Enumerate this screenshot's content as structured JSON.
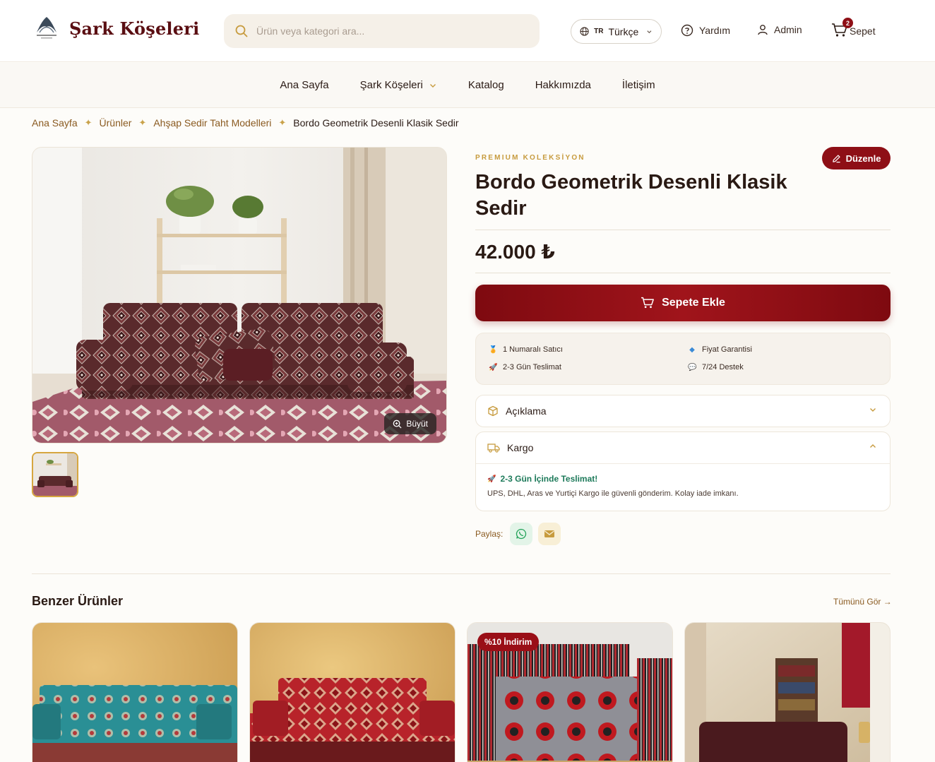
{
  "header": {
    "brand": "Şark Köşeleri",
    "search_placeholder": "Ürün veya kategori ara...",
    "language_code": "TR",
    "language_label": "Türkçe",
    "help_label": "Yardım",
    "account_label": "Admin",
    "cart_label": "Sepet",
    "cart_count": "2"
  },
  "nav": {
    "items": [
      {
        "label": "Ana Sayfa"
      },
      {
        "label": "Şark Köşeleri"
      },
      {
        "label": "Katalog"
      },
      {
        "label": "Hakkımızda"
      },
      {
        "label": "İletişim"
      }
    ]
  },
  "breadcrumb": {
    "items": [
      "Ana Sayfa",
      "Ürünler",
      "Ahşap Sedir Taht Modelleri"
    ],
    "current": "Bordo Geometrik Desenli Klasik Sedir"
  },
  "product": {
    "kicker": "PREMIUM KOLEKSİYON",
    "edit_label": "Düzenle",
    "title": "Bordo Geometrik Desenli Klasik Sedir",
    "price": "42.000 ₺",
    "zoom_label": "Büyüt",
    "add_to_cart": "Sepete Ekle",
    "features": [
      {
        "icon": "trophy-icon",
        "label": "1 Numaralı Satıcı"
      },
      {
        "icon": "diamond-icon",
        "label": "Fiyat Garantisi"
      },
      {
        "icon": "rocket-icon",
        "label": "2-3 Gün Teslimat"
      },
      {
        "icon": "chat-icon",
        "label": "7/24 Destek"
      }
    ],
    "accordion": {
      "description_label": "Açıklama",
      "shipping_label": "Kargo",
      "shipping_highlight": "2-3 Gün İçinde Teslimat!",
      "shipping_text": "UPS, DHL, Aras ve Yurtiçi Kargo ile güvenli gönderim. Kolay iade imkanı."
    },
    "share_label": "Paylaş:"
  },
  "similar": {
    "title": "Benzer Ürünler",
    "see_all": "Tümünü Gör →",
    "cards": [
      {
        "badge": ""
      },
      {
        "badge": ""
      },
      {
        "badge": "%10 İndirim"
      },
      {
        "badge": ""
      }
    ]
  },
  "colors": {
    "brand": "#5a0e12",
    "accent": "#8e0f16",
    "gold": "#c79b3e"
  }
}
